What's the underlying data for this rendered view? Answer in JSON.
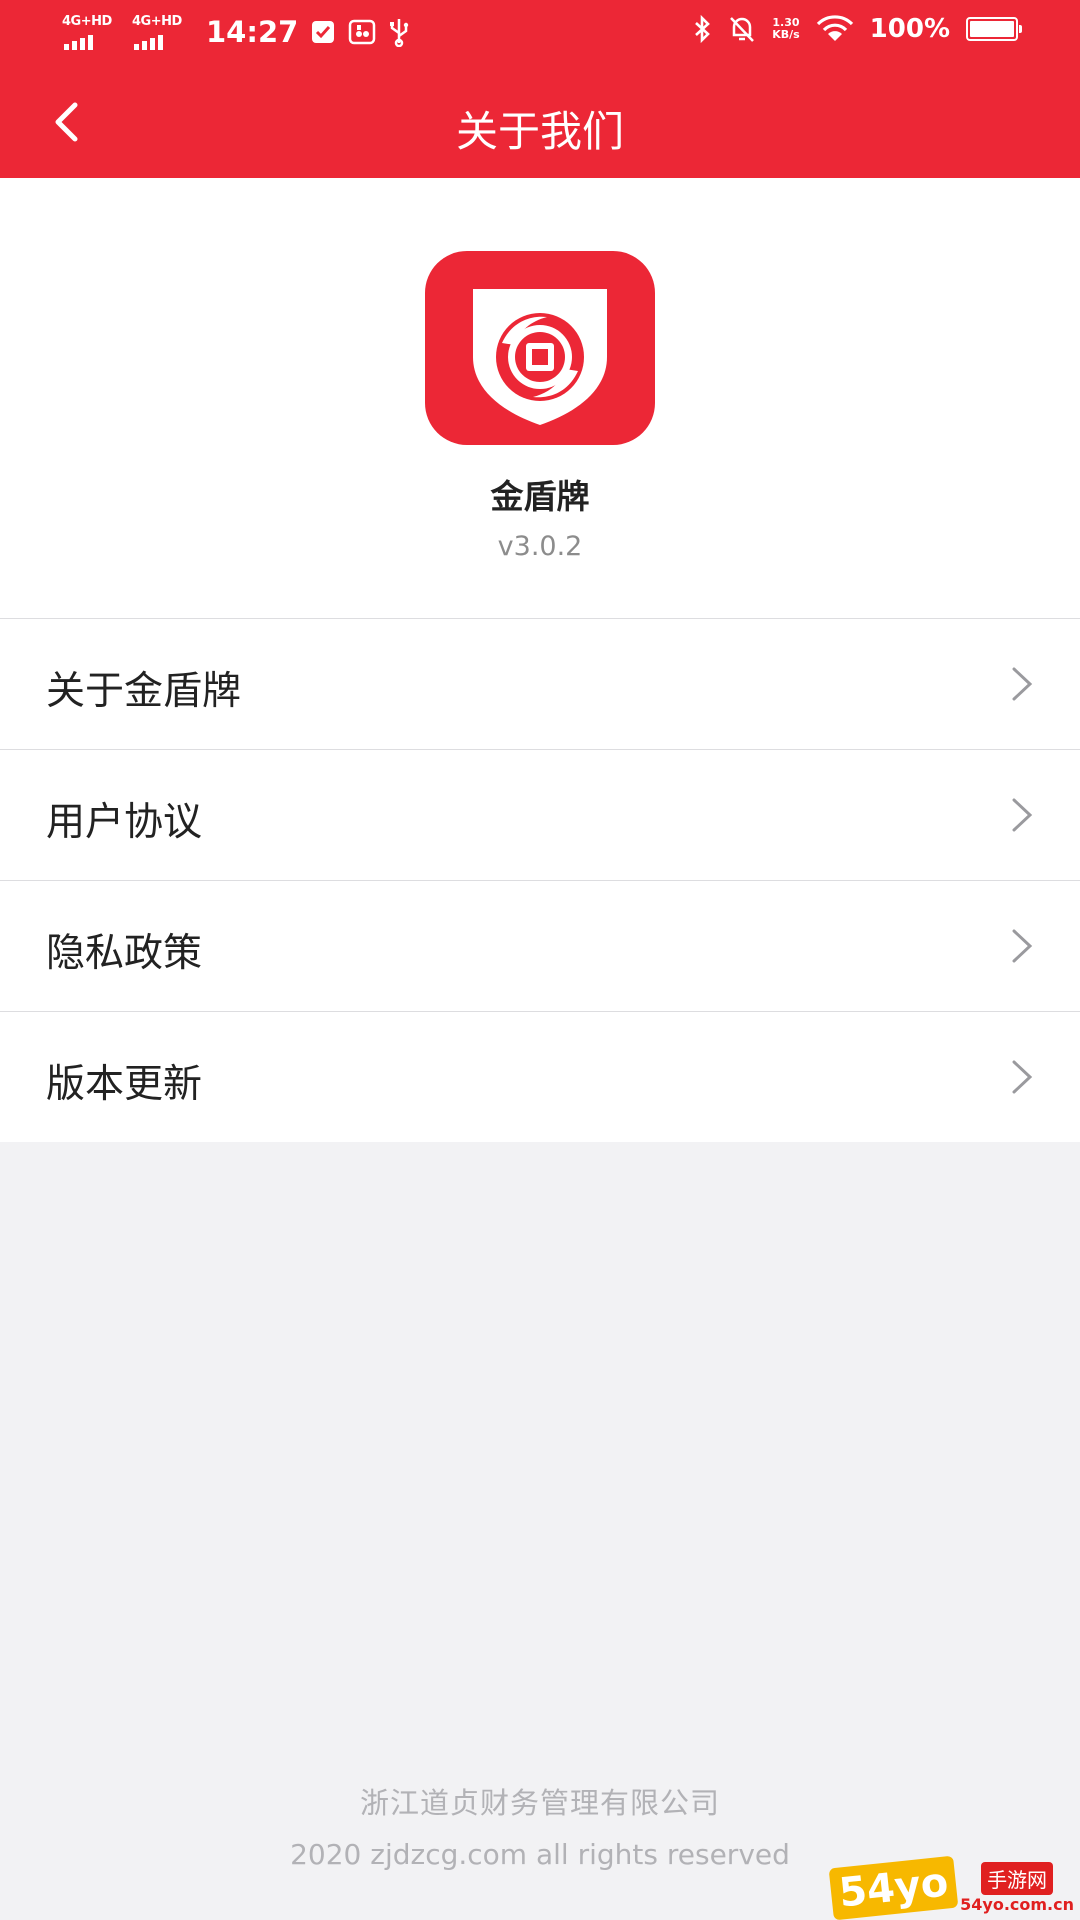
{
  "status_bar": {
    "network_1": "4G+HD",
    "network_2": "4G+HD",
    "time": "14:27",
    "net_speed_value": "1.30",
    "net_speed_unit": "KB/s",
    "battery": "100%",
    "battery_level": 1.0,
    "icons": [
      "check-notification-icon",
      "usb-device-icon",
      "usb-icon",
      "bluetooth-icon",
      "mute-bell-icon",
      "wifi-icon",
      "battery-icon"
    ]
  },
  "navbar": {
    "title": "关于我们",
    "back_icon": "chevron-left-icon"
  },
  "app": {
    "name": "金盾牌",
    "version": "v3.0.2",
    "icon": "shield-logo-icon"
  },
  "menu": [
    {
      "label": "关于金盾牌",
      "icon": "chevron-right-icon"
    },
    {
      "label": "用户协议",
      "icon": "chevron-right-icon"
    },
    {
      "label": "隐私政策",
      "icon": "chevron-right-icon"
    },
    {
      "label": "版本更新",
      "icon": "chevron-right-icon"
    }
  ],
  "footer": {
    "company": "浙江道贞财务管理有限公司",
    "copyright": "2020 zjdzcg.com all rights reserved"
  },
  "watermark": {
    "badge": "54yo",
    "text": "手游网",
    "url": "54yo.com.cn"
  },
  "colors": {
    "brand_red": "#ec2736",
    "background": "#f2f2f4",
    "footer_text": "#b2b2b6"
  }
}
